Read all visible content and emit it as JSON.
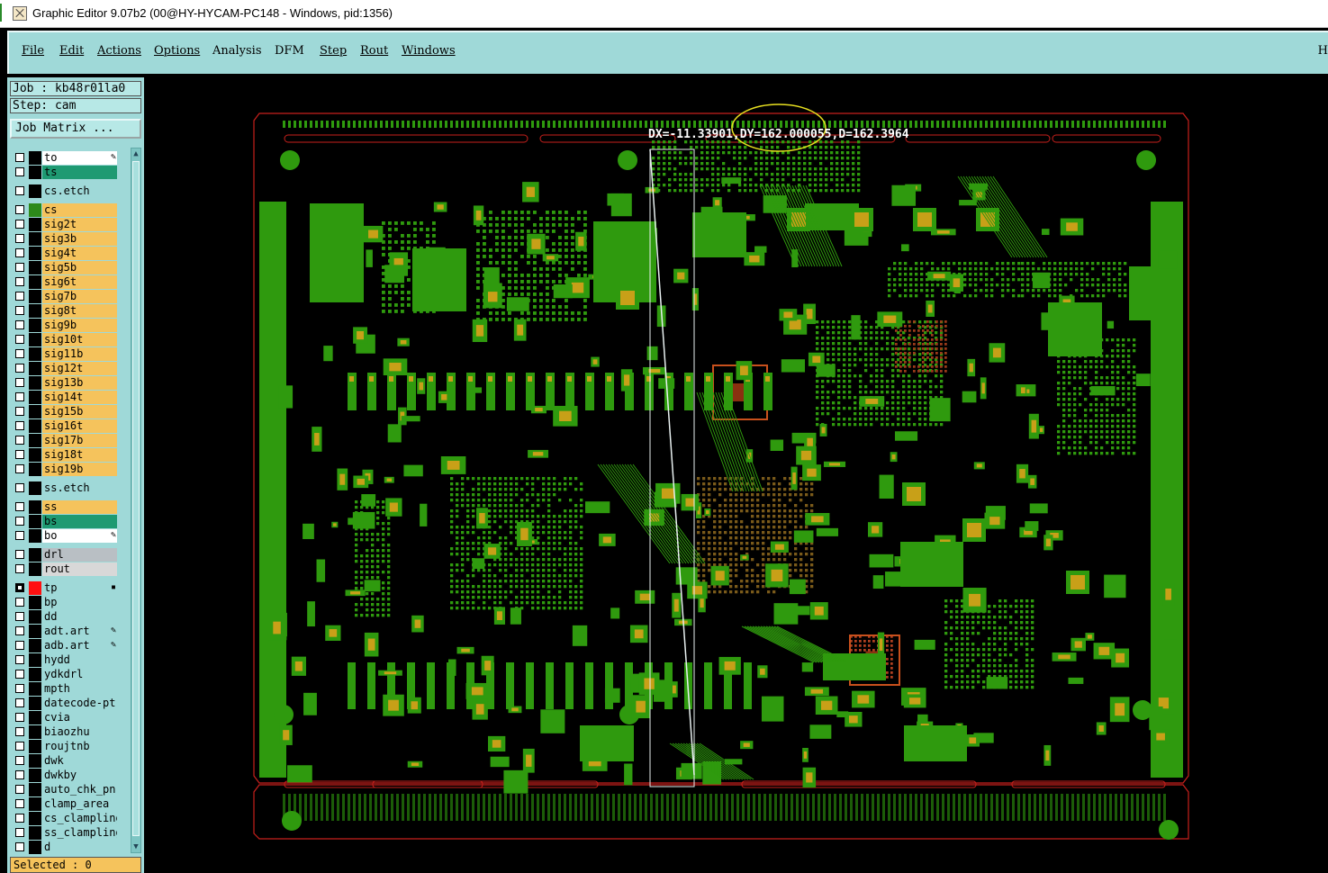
{
  "window": {
    "title": "Graphic Editor 9.07b2 (00@HY-HYCAM-PC148 - Windows, pid:1356)"
  },
  "menu": {
    "items": [
      {
        "label": "File",
        "underline": true
      },
      {
        "label": "Edit",
        "underline": true
      },
      {
        "label": "Actions",
        "underline": true
      },
      {
        "label": "Options",
        "underline": true
      },
      {
        "label": "Analysis",
        "underline": false
      },
      {
        "label": "DFM",
        "underline": false
      },
      {
        "label": "Step",
        "underline": true
      },
      {
        "label": "Rout",
        "underline": true
      },
      {
        "label": "Windows",
        "underline": true
      }
    ],
    "edge_label": "H"
  },
  "panel": {
    "job": "Job : kb48r01la0",
    "step": "Step: cam",
    "job_matrix": "Job Matrix ...",
    "selected": "Selected : 0"
  },
  "layers": [
    {
      "name": "to",
      "color": "#ffffff",
      "mark": "pen",
      "gap_before": false
    },
    {
      "name": "ts",
      "color": "#1e9a72",
      "mark": "",
      "gap_before": false
    },
    {
      "name": "cs.etch",
      "color": "#9fd9d8",
      "mark": "",
      "gap_before": true
    },
    {
      "name": "cs",
      "color": "#f5c35c",
      "mark": "",
      "gap_before": true,
      "swatch": "#2d8a1a"
    },
    {
      "name": "sig2t",
      "color": "#f5c35c",
      "mark": ""
    },
    {
      "name": "sig3b",
      "color": "#f5c35c",
      "mark": ""
    },
    {
      "name": "sig4t",
      "color": "#f5c35c",
      "mark": ""
    },
    {
      "name": "sig5b",
      "color": "#f5c35c",
      "mark": ""
    },
    {
      "name": "sig6t",
      "color": "#f5c35c",
      "mark": ""
    },
    {
      "name": "sig7b",
      "color": "#f5c35c",
      "mark": ""
    },
    {
      "name": "sig8t",
      "color": "#f5c35c",
      "mark": ""
    },
    {
      "name": "sig9b",
      "color": "#f5c35c",
      "mark": ""
    },
    {
      "name": "sig10t",
      "color": "#f5c35c",
      "mark": ""
    },
    {
      "name": "sig11b",
      "color": "#f5c35c",
      "mark": ""
    },
    {
      "name": "sig12t",
      "color": "#f5c35c",
      "mark": ""
    },
    {
      "name": "sig13b",
      "color": "#f5c35c",
      "mark": ""
    },
    {
      "name": "sig14t",
      "color": "#f5c35c",
      "mark": ""
    },
    {
      "name": "sig15b",
      "color": "#f5c35c",
      "mark": ""
    },
    {
      "name": "sig16t",
      "color": "#f5c35c",
      "mark": ""
    },
    {
      "name": "sig17b",
      "color": "#f5c35c",
      "mark": ""
    },
    {
      "name": "sig18t",
      "color": "#f5c35c",
      "mark": ""
    },
    {
      "name": "sig19b",
      "color": "#f5c35c",
      "mark": ""
    },
    {
      "name": "ss.etch",
      "color": "#9fd9d8",
      "mark": "",
      "gap_before": true
    },
    {
      "name": "ss",
      "color": "#f5c35c",
      "mark": "",
      "gap_before": true
    },
    {
      "name": "bs",
      "color": "#1e9a72",
      "mark": ""
    },
    {
      "name": "bo",
      "color": "#ffffff",
      "mark": "pen"
    },
    {
      "name": "drl",
      "color": "#b9bfc4",
      "mark": "",
      "gap_before": true
    },
    {
      "name": "rout",
      "color": "#d8d8d8",
      "mark": ""
    },
    {
      "name": "tp",
      "color": "#9fd9d8",
      "mark": "dot",
      "gap_before": true,
      "swatch": "#ff1010",
      "selected": true
    },
    {
      "name": "bp",
      "color": "#9fd9d8",
      "mark": ""
    },
    {
      "name": "dd",
      "color": "#9fd9d8",
      "mark": ""
    },
    {
      "name": "adt.art",
      "color": "#9fd9d8",
      "mark": "pen"
    },
    {
      "name": "adb.art",
      "color": "#9fd9d8",
      "mark": "pen"
    },
    {
      "name": "hydd",
      "color": "#9fd9d8",
      "mark": ""
    },
    {
      "name": "ydkdrl",
      "color": "#9fd9d8",
      "mark": ""
    },
    {
      "name": "mpth",
      "color": "#9fd9d8",
      "mark": ""
    },
    {
      "name": "datecode-pt",
      "color": "#9fd9d8",
      "mark": ""
    },
    {
      "name": "cvia",
      "color": "#9fd9d8",
      "mark": ""
    },
    {
      "name": "biaozhu",
      "color": "#9fd9d8",
      "mark": ""
    },
    {
      "name": "roujtnb",
      "color": "#9fd9d8",
      "mark": ""
    },
    {
      "name": "dwk",
      "color": "#9fd9d8",
      "mark": ""
    },
    {
      "name": "dwkby",
      "color": "#9fd9d8",
      "mark": ""
    },
    {
      "name": "auto_chk_pn",
      "color": "#9fd9d8",
      "mark": ""
    },
    {
      "name": "clamp_area",
      "color": "#9fd9d8",
      "mark": ""
    },
    {
      "name": "cs_clampling",
      "color": "#9fd9d8",
      "mark": ""
    },
    {
      "name": "ss_clampling",
      "color": "#9fd9d8",
      "mark": ""
    },
    {
      "name": "d",
      "color": "#9fd9d8",
      "mark": ""
    }
  ],
  "canvas": {
    "measure_readout": "DX=-11.33901,DY=162.000055,D=162.3964",
    "colors": {
      "board": "#000000",
      "copper": "#2f9a0e",
      "pad": "#c8a018",
      "outline": "#c8201c",
      "measure": "#e8f0f0",
      "highlight": "#e8e020"
    }
  }
}
